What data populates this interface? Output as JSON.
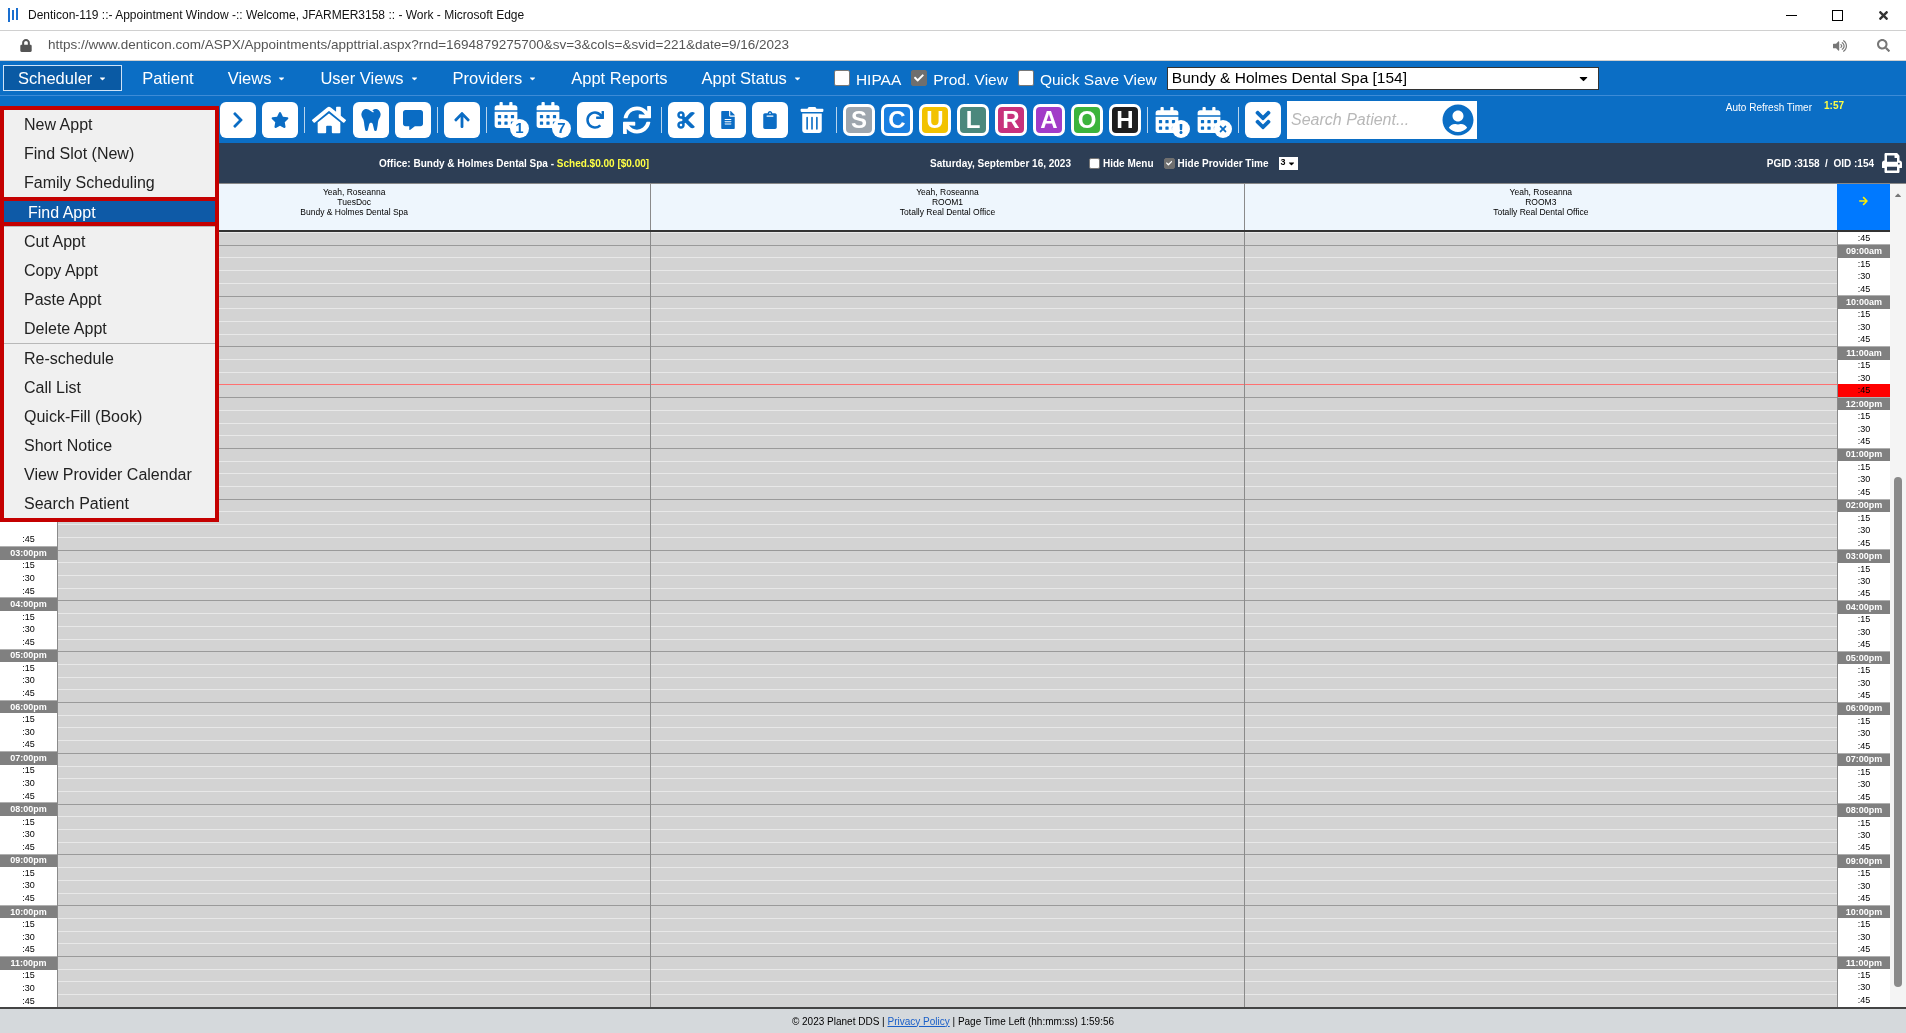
{
  "window": {
    "title": "Denticon-119 ::- Appointment Window -:: Welcome, JFARMER3158 :: - Work - Microsoft Edge"
  },
  "address_bar": {
    "url": "https://www.denticon.com/ASPX/Appointments/appttrial.aspx?rnd=1694879275700&sv=3&cols=&svid=221&date=9/16/2023"
  },
  "menu_bar": {
    "items": [
      {
        "label": "Scheduler",
        "has_dropdown": true,
        "selected": true
      },
      {
        "label": "Patient",
        "has_dropdown": false,
        "selected": false
      },
      {
        "label": "Views",
        "has_dropdown": true,
        "selected": false
      },
      {
        "label": "User Views",
        "has_dropdown": true,
        "selected": false
      },
      {
        "label": "Providers",
        "has_dropdown": true,
        "selected": false
      },
      {
        "label": "Appt Reports",
        "has_dropdown": false,
        "selected": false
      },
      {
        "label": "Appt Status",
        "has_dropdown": true,
        "selected": false
      }
    ],
    "checkboxes": [
      {
        "label": "HIPAA",
        "checked": false
      },
      {
        "label": "Prod. View",
        "checked": true
      },
      {
        "label": "Quick Save View",
        "checked": false
      }
    ],
    "office_select": {
      "value": "Bundy & Holmes Dental Spa [154]"
    }
  },
  "scheduler_menu": {
    "sections": [
      {
        "items": [
          {
            "label": "New Appt",
            "selected": false
          },
          {
            "label": "Find Slot (New)",
            "selected": false
          },
          {
            "label": "Family Scheduling",
            "selected": false
          },
          {
            "label": "Find Appt",
            "selected": true
          }
        ]
      },
      {
        "items": [
          {
            "label": "Cut Appt",
            "selected": false
          },
          {
            "label": "Copy Appt",
            "selected": false
          },
          {
            "label": "Paste Appt",
            "selected": false
          },
          {
            "label": "Delete Appt",
            "selected": false
          }
        ]
      },
      {
        "items": [
          {
            "label": "Re-schedule",
            "selected": false
          },
          {
            "label": "Call List",
            "selected": false
          },
          {
            "label": "Quick-Fill (Book)",
            "selected": false
          },
          {
            "label": "Short Notice",
            "selected": false
          },
          {
            "label": "View Provider Calendar",
            "selected": false
          },
          {
            "label": "Search Patient",
            "selected": false
          }
        ]
      }
    ]
  },
  "toolbar": {
    "day_badge": "1",
    "week_badge": "7",
    "status_buttons": [
      {
        "letter": "S",
        "color": "#9ea6ae"
      },
      {
        "letter": "C",
        "color": "#1a7fe0"
      },
      {
        "letter": "U",
        "color": "#f2c200"
      },
      {
        "letter": "L",
        "color": "#4b887d"
      },
      {
        "letter": "R",
        "color": "#c8327c"
      },
      {
        "letter": "A",
        "color": "#a23cc8"
      },
      {
        "letter": "O",
        "color": "#3cb43c"
      },
      {
        "letter": "H",
        "color": "#1e1e1e"
      }
    ],
    "search": {
      "placeholder": "Search Patient..."
    },
    "auto_refresh": {
      "label": "Auto Refresh Timer",
      "value": "1:57"
    }
  },
  "info_bar": {
    "office": "Office: Bundy & Holmes Dental Spa - ",
    "sched": "Sched.$0.00 [$0.00]",
    "date": "Saturday, September 16, 2023",
    "options": [
      {
        "label": "Hide Menu",
        "checked": false
      },
      {
        "label": "Hide Provider Time",
        "checked": true
      }
    ],
    "columns_select": "3",
    "ids": "PGID :3158  /  OID :154"
  },
  "columns": [
    {
      "lines": [
        "Yeah, Roseanna",
        "TuesDoc",
        "Bundy & Holmes Dental Spa"
      ]
    },
    {
      "lines": [
        "Yeah, Roseanna",
        "ROOM1",
        "Totally Real Dental Office"
      ]
    },
    {
      "lines": [
        "Yeah, Roseanna",
        "ROOM3",
        "Totally Real Dental Office"
      ]
    }
  ],
  "time_slots": [
    {
      "label": ":45",
      "kind": "quarter",
      "current": false
    },
    {
      "label": "09:00am",
      "kind": "hour",
      "current": false
    },
    {
      "label": ":15",
      "kind": "quarter",
      "current": false
    },
    {
      "label": ":30",
      "kind": "quarter",
      "current": false
    },
    {
      "label": ":45",
      "kind": "quarter",
      "current": false
    },
    {
      "label": "10:00am",
      "kind": "hour",
      "current": false
    },
    {
      "label": ":15",
      "kind": "quarter",
      "current": false
    },
    {
      "label": ":30",
      "kind": "quarter",
      "current": false
    },
    {
      "label": ":45",
      "kind": "quarter",
      "current": false
    },
    {
      "label": "11:00am",
      "kind": "hour",
      "current": false
    },
    {
      "label": ":15",
      "kind": "quarter",
      "current": false
    },
    {
      "label": ":30",
      "kind": "quarter",
      "current": false
    },
    {
      "label": ":45",
      "kind": "quarter",
      "current": true
    },
    {
      "label": "12:00pm",
      "kind": "hour",
      "current": false
    },
    {
      "label": ":15",
      "kind": "quarter",
      "current": false
    },
    {
      "label": ":30",
      "kind": "quarter",
      "current": false
    },
    {
      "label": ":45",
      "kind": "quarter",
      "current": false
    },
    {
      "label": "01:00pm",
      "kind": "hour",
      "current": false
    },
    {
      "label": ":15",
      "kind": "quarter",
      "current": false
    },
    {
      "label": ":30",
      "kind": "quarter",
      "current": false
    },
    {
      "label": ":45",
      "kind": "quarter",
      "current": false
    },
    {
      "label": "02:00pm",
      "kind": "hour",
      "current": false
    },
    {
      "label": ":15",
      "kind": "quarter",
      "current": false
    },
    {
      "label": ":30",
      "kind": "quarter",
      "current": false
    },
    {
      "label": ":45",
      "kind": "quarter",
      "current": false
    },
    {
      "label": "03:00pm",
      "kind": "hour",
      "current": false
    },
    {
      "label": ":15",
      "kind": "quarter",
      "current": false
    },
    {
      "label": ":30",
      "kind": "quarter",
      "current": false
    },
    {
      "label": ":45",
      "kind": "quarter",
      "current": false
    },
    {
      "label": "04:00pm",
      "kind": "hour",
      "current": false
    },
    {
      "label": ":15",
      "kind": "quarter",
      "current": false
    },
    {
      "label": ":30",
      "kind": "quarter",
      "current": false
    },
    {
      "label": ":45",
      "kind": "quarter",
      "current": false
    },
    {
      "label": "05:00pm",
      "kind": "hour",
      "current": false
    },
    {
      "label": ":15",
      "kind": "quarter",
      "current": false
    },
    {
      "label": ":30",
      "kind": "quarter",
      "current": false
    },
    {
      "label": ":45",
      "kind": "quarter",
      "current": false
    },
    {
      "label": "06:00pm",
      "kind": "hour",
      "current": false
    },
    {
      "label": ":15",
      "kind": "quarter",
      "current": false
    },
    {
      "label": ":30",
      "kind": "quarter",
      "current": false
    },
    {
      "label": ":45",
      "kind": "quarter",
      "current": false
    },
    {
      "label": "07:00pm",
      "kind": "hour",
      "current": false
    },
    {
      "label": ":15",
      "kind": "quarter",
      "current": false
    },
    {
      "label": ":30",
      "kind": "quarter",
      "current": false
    },
    {
      "label": ":45",
      "kind": "quarter",
      "current": false
    },
    {
      "label": "08:00pm",
      "kind": "hour",
      "current": false
    },
    {
      "label": ":15",
      "kind": "quarter",
      "current": false
    },
    {
      "label": ":30",
      "kind": "quarter",
      "current": false
    },
    {
      "label": ":45",
      "kind": "quarter",
      "current": false
    },
    {
      "label": "09:00pm",
      "kind": "hour",
      "current": false
    },
    {
      "label": ":15",
      "kind": "quarter",
      "current": false
    },
    {
      "label": ":30",
      "kind": "quarter",
      "current": false
    },
    {
      "label": ":45",
      "kind": "quarter",
      "current": false
    },
    {
      "label": "10:00pm",
      "kind": "hour",
      "current": false
    },
    {
      "label": ":15",
      "kind": "quarter",
      "current": false
    },
    {
      "label": ":30",
      "kind": "quarter",
      "current": false
    },
    {
      "label": ":45",
      "kind": "quarter",
      "current": false
    },
    {
      "label": "11:00pm",
      "kind": "hour",
      "current": false
    },
    {
      "label": ":15",
      "kind": "quarter",
      "current": false
    },
    {
      "label": ":30",
      "kind": "quarter",
      "current": false
    },
    {
      "label": ":45",
      "kind": "quarter",
      "current": false
    }
  ],
  "left_time_column": [
    {
      "label": ":45",
      "kind": "quarter"
    },
    {
      "label": "03:00pm",
      "kind": "hour"
    },
    {
      "label": ":15",
      "kind": "quarter"
    },
    {
      "label": ":30",
      "kind": "quarter"
    },
    {
      "label": ":45",
      "kind": "quarter"
    },
    {
      "label": "04:00pm",
      "kind": "hour"
    },
    {
      "label": ":15",
      "kind": "quarter"
    },
    {
      "label": ":30",
      "kind": "quarter"
    },
    {
      "label": ":45",
      "kind": "quarter"
    },
    {
      "label": "05:00pm",
      "kind": "hour"
    },
    {
      "label": ":15",
      "kind": "quarter"
    },
    {
      "label": ":30",
      "kind": "quarter"
    },
    {
      "label": ":45",
      "kind": "quarter"
    },
    {
      "label": "06:00pm",
      "kind": "hour"
    },
    {
      "label": ":15",
      "kind": "quarter"
    },
    {
      "label": ":30",
      "kind": "quarter"
    },
    {
      "label": ":45",
      "kind": "quarter"
    },
    {
      "label": "07:00pm",
      "kind": "hour"
    },
    {
      "label": ":15",
      "kind": "quarter"
    },
    {
      "label": ":30",
      "kind": "quarter"
    },
    {
      "label": ":45",
      "kind": "quarter"
    },
    {
      "label": "08:00pm",
      "kind": "hour"
    },
    {
      "label": ":15",
      "kind": "quarter"
    },
    {
      "label": ":30",
      "kind": "quarter"
    },
    {
      "label": ":45",
      "kind": "quarter"
    },
    {
      "label": "09:00pm",
      "kind": "hour"
    },
    {
      "label": ":15",
      "kind": "quarter"
    },
    {
      "label": ":30",
      "kind": "quarter"
    },
    {
      "label": ":45",
      "kind": "quarter"
    },
    {
      "label": "10:00pm",
      "kind": "hour"
    },
    {
      "label": ":15",
      "kind": "quarter"
    },
    {
      "label": ":30",
      "kind": "quarter"
    },
    {
      "label": ":45",
      "kind": "quarter"
    },
    {
      "label": "11:00pm",
      "kind": "hour"
    },
    {
      "label": ":15",
      "kind": "quarter"
    },
    {
      "label": ":30",
      "kind": "quarter"
    },
    {
      "label": ":45",
      "kind": "quarter"
    }
  ],
  "footer": {
    "copyright": "© 2023 Planet DDS |",
    "link": "Privacy Policy",
    "timer": "| Page Time Left (hh:mm:ss) 1:59:56"
  }
}
